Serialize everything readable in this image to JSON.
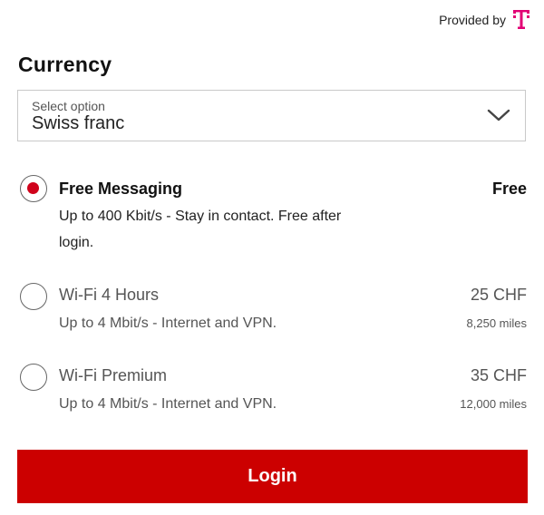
{
  "header": {
    "provided_by": "Provided by",
    "logo_icon": "t-logo-icon",
    "logo_color": "#e20074"
  },
  "currency": {
    "title": "Currency",
    "select_label": "Select option",
    "select_value": "Swiss franc",
    "dropdown_icon": "chevron-down-icon"
  },
  "options": [
    {
      "name": "Free Messaging",
      "price": "Free",
      "description": "Up to 400 Kbit/s - Stay in contact. Free after login.",
      "miles": "",
      "selected": true
    },
    {
      "name": "Wi-Fi 4 Hours",
      "price": "25 CHF",
      "description": "Up to 4 Mbit/s - Internet and VPN.",
      "miles": "8,250 miles",
      "selected": false
    },
    {
      "name": "Wi-Fi Premium",
      "price": "35 CHF",
      "description": "Up to 4 Mbit/s - Internet and VPN.",
      "miles": "12,000 miles",
      "selected": false
    }
  ],
  "actions": {
    "login_label": "Login"
  },
  "colors": {
    "accent": "#cc0000",
    "radio_selected": "#d0021b"
  }
}
